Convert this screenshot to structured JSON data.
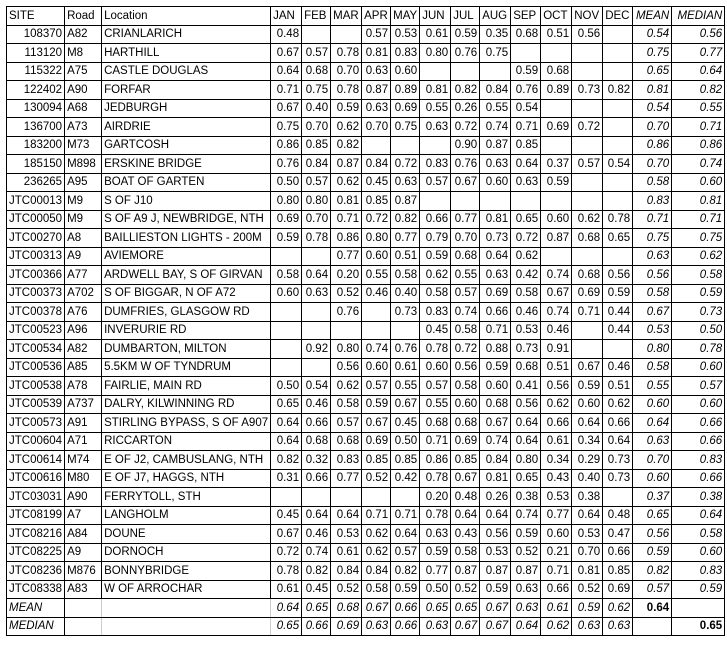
{
  "headers": [
    "SITE",
    "Road",
    "Location",
    "JAN",
    "FEB",
    "MAR",
    "APR",
    "MAY",
    "JUN",
    "JUL",
    "AUG",
    "SEP",
    "OCT",
    "NOV",
    "DEC",
    "MEAN",
    "MEDIAN"
  ],
  "rows": [
    {
      "site": "108370",
      "road": "A82",
      "location": "CRIANLARICH",
      "values": [
        "0.48",
        "",
        "",
        "0.57",
        "0.53",
        "0.61",
        "0.59",
        "0.35",
        "0.68",
        "0.51",
        "0.56",
        "",
        "0.54",
        "0.56"
      ]
    },
    {
      "site": "113120",
      "road": "M8",
      "location": "HARTHILL",
      "values": [
        "0.67",
        "0.57",
        "0.78",
        "0.81",
        "0.83",
        "0.80",
        "0.76",
        "0.75",
        "",
        "",
        "",
        "",
        "0.75",
        "0.77"
      ]
    },
    {
      "site": "115322",
      "road": "A75",
      "location": "CASTLE DOUGLAS",
      "values": [
        "0.64",
        "0.68",
        "0.70",
        "0.63",
        "0.60",
        "",
        "",
        "",
        "0.59",
        "0.68",
        "",
        "",
        "0.65",
        "0.64"
      ]
    },
    {
      "site": "122402",
      "road": "A90",
      "location": "FORFAR",
      "values": [
        "0.71",
        "0.75",
        "0.78",
        "0.87",
        "0.89",
        "0.81",
        "0.82",
        "0.84",
        "0.76",
        "0.89",
        "0.73",
        "0.82",
        "0.81",
        "0.82"
      ]
    },
    {
      "site": "130094",
      "road": "A68",
      "location": "JEDBURGH",
      "values": [
        "0.67",
        "0.40",
        "0.59",
        "0.63",
        "0.69",
        "0.55",
        "0.26",
        "0.55",
        "0.54",
        "",
        "",
        "",
        "0.54",
        "0.55"
      ]
    },
    {
      "site": "136700",
      "road": "A73",
      "location": "AIRDRIE",
      "values": [
        "0.75",
        "0.70",
        "0.62",
        "0.70",
        "0.75",
        "0.63",
        "0.72",
        "0.74",
        "0.71",
        "0.69",
        "0.72",
        "",
        "0.70",
        "0.71"
      ]
    },
    {
      "site": "183200",
      "road": "M73",
      "location": "GARTCOSH",
      "values": [
        "0.86",
        "0.85",
        "0.82",
        "",
        "",
        "",
        "0.90",
        "0.87",
        "0.85",
        "",
        "",
        "",
        "0.86",
        "0.86"
      ]
    },
    {
      "site": "185150",
      "road": "M898",
      "location": "ERSKINE BRIDGE",
      "values": [
        "0.76",
        "0.84",
        "0.87",
        "0.84",
        "0.72",
        "0.83",
        "0.76",
        "0.63",
        "0.64",
        "0.37",
        "0.57",
        "0.54",
        "0.70",
        "0.74"
      ]
    },
    {
      "site": "236265",
      "road": "A95",
      "location": "BOAT OF GARTEN",
      "values": [
        "0.50",
        "0.57",
        "0.62",
        "0.45",
        "0.63",
        "0.57",
        "0.67",
        "0.60",
        "0.63",
        "0.59",
        "",
        "",
        "0.58",
        "0.60"
      ]
    },
    {
      "site": "JTC00013",
      "road": "M9",
      "location": "S OF J10",
      "values": [
        "0.80",
        "0.80",
        "0.81",
        "0.85",
        "0.87",
        "",
        "",
        "",
        "",
        "",
        "",
        "",
        "0.83",
        "0.81"
      ]
    },
    {
      "site": "JTC00050",
      "road": "M9",
      "location": "S OF A9 J, NEWBRIDGE, NTH",
      "values": [
        "0.69",
        "0.70",
        "0.71",
        "0.72",
        "0.82",
        "0.66",
        "0.77",
        "0.81",
        "0.65",
        "0.60",
        "0.62",
        "0.78",
        "0.71",
        "0.71"
      ]
    },
    {
      "site": "JTC00270",
      "road": "A8",
      "location": "BAILLIESTON LIGHTS - 200M",
      "values": [
        "0.59",
        "0.78",
        "0.86",
        "0.80",
        "0.77",
        "0.79",
        "0.70",
        "0.73",
        "0.72",
        "0.87",
        "0.68",
        "0.65",
        "0.75",
        "0.75"
      ]
    },
    {
      "site": "JTC00313",
      "road": "A9",
      "location": "AVIEMORE",
      "values": [
        "",
        "",
        "0.77",
        "0.60",
        "0.51",
        "0.59",
        "0.68",
        "0.64",
        "0.62",
        "",
        "",
        "",
        "0.63",
        "0.62"
      ]
    },
    {
      "site": "JTC00366",
      "road": "A77",
      "location": "ARDWELL BAY, S OF GIRVAN",
      "values": [
        "0.58",
        "0.64",
        "0.20",
        "0.55",
        "0.58",
        "0.62",
        "0.55",
        "0.63",
        "0.42",
        "0.74",
        "0.68",
        "0.56",
        "0.56",
        "0.58"
      ]
    },
    {
      "site": "JTC00373",
      "road": "A702",
      "location": "S OF BIGGAR, N OF A72",
      "values": [
        "0.60",
        "0.63",
        "0.52",
        "0.46",
        "0.40",
        "0.58",
        "0.57",
        "0.69",
        "0.58",
        "0.67",
        "0.69",
        "0.59",
        "0.58",
        "0.59"
      ]
    },
    {
      "site": "JTC00378",
      "road": "A76",
      "location": "DUMFRIES, GLASGOW RD",
      "values": [
        "",
        "",
        "0.76",
        "",
        "0.73",
        "0.83",
        "0.74",
        "0.66",
        "0.46",
        "0.74",
        "0.71",
        "0.44",
        "0.67",
        "0.73"
      ]
    },
    {
      "site": "JTC00523",
      "road": "A96",
      "location": "INVERURIE RD",
      "values": [
        "",
        "",
        "",
        "",
        "",
        "0.45",
        "0.58",
        "0.71",
        "0.53",
        "0.46",
        "",
        "0.44",
        "0.53",
        "0.50"
      ]
    },
    {
      "site": "JTC00534",
      "road": "A82",
      "location": "DUMBARTON, MILTON",
      "values": [
        "",
        "0.92",
        "0.80",
        "0.74",
        "0.76",
        "0.78",
        "0.72",
        "0.88",
        "0.73",
        "0.91",
        "",
        "",
        "0.80",
        "0.78"
      ]
    },
    {
      "site": "JTC00536",
      "road": "A85",
      "location": "5.5KM W OF TYNDRUM",
      "values": [
        "",
        "",
        "0.56",
        "0.60",
        "0.61",
        "0.60",
        "0.56",
        "0.59",
        "0.68",
        "0.51",
        "0.67",
        "0.46",
        "0.58",
        "0.60"
      ]
    },
    {
      "site": "JTC00538",
      "road": "A78",
      "location": "FAIRLIE, MAIN RD",
      "values": [
        "0.50",
        "0.54",
        "0.62",
        "0.57",
        "0.55",
        "0.57",
        "0.58",
        "0.60",
        "0.41",
        "0.56",
        "0.59",
        "0.51",
        "0.55",
        "0.57"
      ]
    },
    {
      "site": "JTC00539",
      "road": "A737",
      "location": "DALRY, KILWINNING RD",
      "values": [
        "0.65",
        "0.46",
        "0.58",
        "0.59",
        "0.67",
        "0.55",
        "0.60",
        "0.68",
        "0.56",
        "0.62",
        "0.60",
        "0.62",
        "0.60",
        "0.60"
      ]
    },
    {
      "site": "JTC00573",
      "road": "A91",
      "location": "STIRLING BYPASS, S OF A907",
      "values": [
        "0.64",
        "0.66",
        "0.57",
        "0.67",
        "0.45",
        "0.68",
        "0.68",
        "0.67",
        "0.64",
        "0.66",
        "0.64",
        "0.66",
        "0.64",
        "0.66"
      ]
    },
    {
      "site": "JTC00604",
      "road": "A71",
      "location": "RICCARTON",
      "values": [
        "0.64",
        "0.68",
        "0.68",
        "0.69",
        "0.50",
        "0.71",
        "0.69",
        "0.74",
        "0.64",
        "0.61",
        "0.34",
        "0.64",
        "0.63",
        "0.66"
      ]
    },
    {
      "site": "JTC00614",
      "road": "M74",
      "location": "E OF J2, CAMBUSLANG, NTH",
      "values": [
        "0.82",
        "0.32",
        "0.83",
        "0.85",
        "0.85",
        "0.86",
        "0.85",
        "0.84",
        "0.80",
        "0.34",
        "0.29",
        "0.73",
        "0.70",
        "0.83"
      ]
    },
    {
      "site": "JTC00616",
      "road": "M80",
      "location": "E OF J7, HAGGS, NTH",
      "values": [
        "0.31",
        "0.66",
        "0.77",
        "0.52",
        "0.42",
        "0.78",
        "0.67",
        "0.81",
        "0.65",
        "0.43",
        "0.40",
        "0.73",
        "0.60",
        "0.66"
      ]
    },
    {
      "site": "JTC03031",
      "road": "A90",
      "location": "FERRYTOLL, STH",
      "values": [
        "",
        "",
        "",
        "",
        "",
        "0.20",
        "0.48",
        "0.26",
        "0.38",
        "0.53",
        "0.38",
        "",
        "0.37",
        "0.38"
      ]
    },
    {
      "site": "JTC08199",
      "road": "A7",
      "location": "LANGHOLM",
      "values": [
        "0.45",
        "0.64",
        "0.64",
        "0.71",
        "0.71",
        "0.78",
        "0.64",
        "0.64",
        "0.74",
        "0.77",
        "0.64",
        "0.48",
        "0.65",
        "0.64"
      ]
    },
    {
      "site": "JTC08216",
      "road": "A84",
      "location": "DOUNE",
      "values": [
        "0.67",
        "0.46",
        "0.53",
        "0.62",
        "0.64",
        "0.63",
        "0.43",
        "0.56",
        "0.59",
        "0.60",
        "0.53",
        "0.47",
        "0.56",
        "0.58"
      ]
    },
    {
      "site": "JTC08225",
      "road": "A9",
      "location": "DORNOCH",
      "values": [
        "0.72",
        "0.74",
        "0.61",
        "0.62",
        "0.57",
        "0.59",
        "0.58",
        "0.53",
        "0.52",
        "0.21",
        "0.70",
        "0.66",
        "0.59",
        "0.60"
      ]
    },
    {
      "site": "JTC08236",
      "road": "M876",
      "location": "BONNYBRIDGE",
      "values": [
        "0.78",
        "0.82",
        "0.84",
        "0.84",
        "0.82",
        "0.77",
        "0.87",
        "0.87",
        "0.87",
        "0.71",
        "0.81",
        "0.85",
        "0.82",
        "0.83"
      ]
    },
    {
      "site": "JTC08338",
      "road": "A83",
      "location": "W OF ARROCHAR",
      "values": [
        "0.61",
        "0.45",
        "0.52",
        "0.58",
        "0.59",
        "0.50",
        "0.52",
        "0.59",
        "0.63",
        "0.66",
        "0.52",
        "0.69",
        "0.57",
        "0.59"
      ]
    }
  ],
  "summary": [
    {
      "label": "MEAN",
      "values": [
        "0.64",
        "0.65",
        "0.68",
        "0.67",
        "0.66",
        "0.65",
        "0.65",
        "0.67",
        "0.63",
        "0.61",
        "0.59",
        "0.62",
        "0.64",
        ""
      ]
    },
    {
      "label": "MEDIAN",
      "values": [
        "0.65",
        "0.66",
        "0.69",
        "0.63",
        "0.66",
        "0.63",
        "0.67",
        "0.67",
        "0.64",
        "0.62",
        "0.63",
        "0.63",
        "",
        "0.65"
      ]
    }
  ]
}
